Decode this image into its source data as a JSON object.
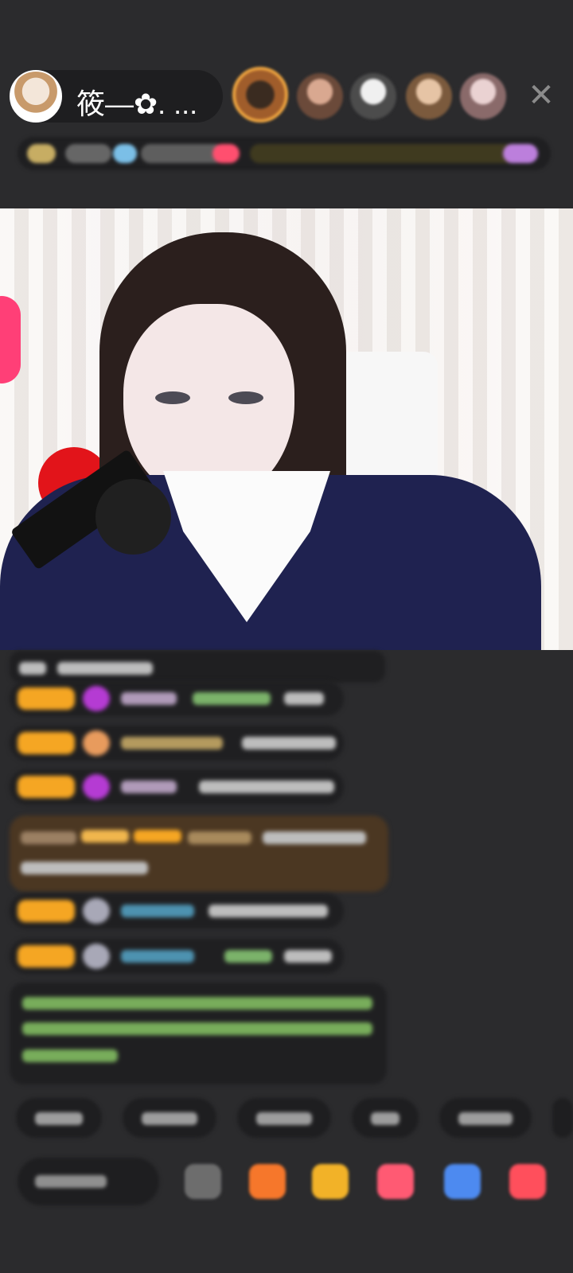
{
  "host": {
    "name": "筱—✿. ..."
  },
  "top_controls": {
    "close_symbol": "✕"
  },
  "colors": {
    "background": "#2b2b2d",
    "pill": "#1e1e20",
    "badge": "#f5a623",
    "gift_message_bg": "#4b3722"
  },
  "icons": {
    "avatar": "host-avatar",
    "viewers": [
      "viewer-avatar",
      "viewer-avatar",
      "viewer-avatar",
      "viewer-avatar",
      "viewer-avatar"
    ],
    "actions": [
      "emoji-icon",
      "gift-box-icon",
      "treasure-icon",
      "heart-icon",
      "game-icon",
      "grid-icon"
    ]
  }
}
